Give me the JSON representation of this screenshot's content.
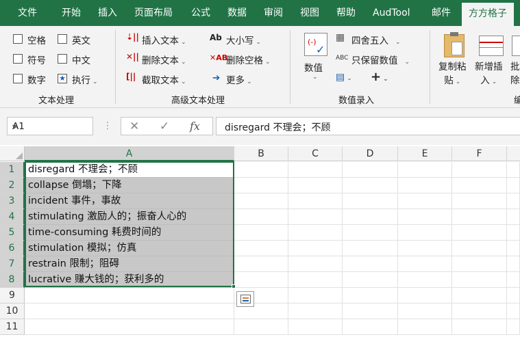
{
  "tabs": [
    "文件",
    "开始",
    "插入",
    "页面布局",
    "公式",
    "数据",
    "审阅",
    "视图",
    "帮助",
    "AudTool",
    "邮件",
    "方方格子"
  ],
  "ribbon": {
    "text_group": {
      "items": [
        "空格",
        "英文",
        "符号",
        "中文",
        "数字",
        "执行"
      ],
      "label": "文本处理"
    },
    "advanced_group": {
      "items": [
        "插入文本",
        "删除文本",
        "截取文本",
        "大小写",
        "删除空格",
        "更多"
      ],
      "label": "高级文本处理"
    },
    "numeric_group": {
      "value_button": "数值",
      "round_label": "四舍五入",
      "keep_value_label": "只保留数值",
      "label": "数值录入"
    },
    "paste_group": {
      "copy_paste": [
        "复制粘",
        "贴"
      ],
      "add_insert": [
        "新增插",
        "入"
      ],
      "batch": [
        "批",
        "除"
      ],
      "label_partial": "编"
    }
  },
  "formula_bar": {
    "name_box": "A1",
    "fx": "fx",
    "content": "disregard 不理会；不顾"
  },
  "columns": [
    "A",
    "B",
    "C",
    "D",
    "E",
    "F"
  ],
  "rows": [
    "1",
    "2",
    "3",
    "4",
    "5",
    "6",
    "7",
    "8",
    "9",
    "10",
    "11"
  ],
  "cells": [
    "disregard 不理会；不顾",
    "collapse 倒塌；下降",
    "incident 事件，事故",
    "stimulating 激励人的；振奋人心的",
    "time-consuming 耗费时间的",
    "stimulation 模拟；仿真",
    "restrain 限制；阻碍",
    "lucrative 赚大钱的；获利多的"
  ]
}
